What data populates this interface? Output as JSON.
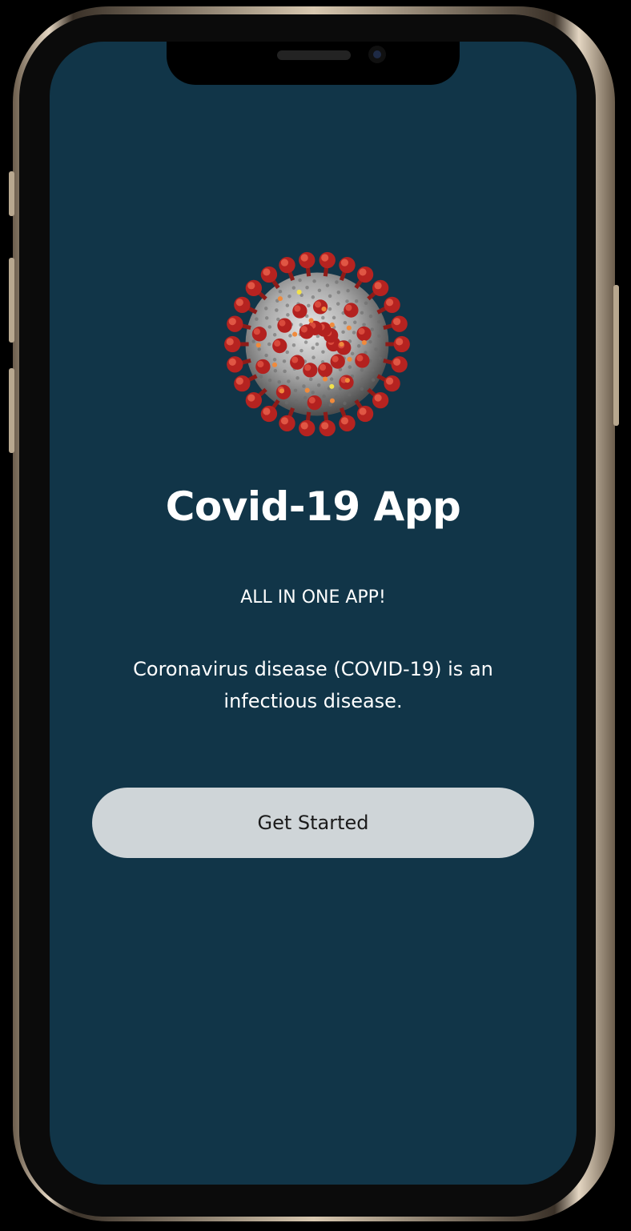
{
  "device": {
    "frame_color": "#d8c8b0",
    "screen_color": "#113548"
  },
  "splash": {
    "illustration": "coronavirus-illustration",
    "title": "Covid-19 App",
    "tagline": "ALL IN ONE APP!",
    "description": "Coronavirus disease (COVID-19) is an infectious disease.",
    "cta_label": "Get Started",
    "cta_color": "#cfd5d8"
  }
}
